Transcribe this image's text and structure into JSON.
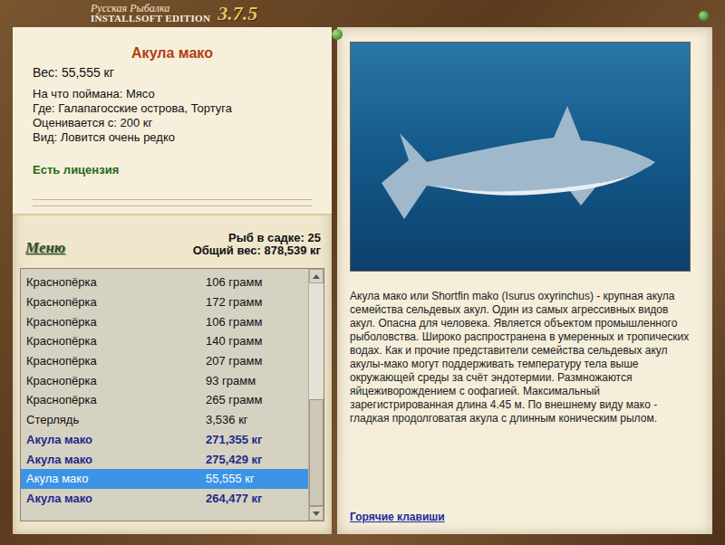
{
  "window": {
    "title_line1": "Русская Рыбалка",
    "title_line2": "INSTALLSOFT EDITION",
    "version": "3.7.5"
  },
  "fish": {
    "name": "Акула мако",
    "weight": "Вес: 55,555 кг",
    "details": [
      "На что поймана: Мясо",
      "Где: Галапагосские острова, Тортуга",
      "Оценивается с: 200 кг",
      "Вид: Ловится очень редко"
    ],
    "license": "Есть лицензия"
  },
  "menu": "Меню",
  "cage": {
    "count": "Рыб в садке: 25",
    "total": "Общий вес: 878,539 кг"
  },
  "catch_list": [
    {
      "name": "Краснопёрка",
      "weight": "106 грамм",
      "trophy": false,
      "selected": false
    },
    {
      "name": "Краснопёрка",
      "weight": "172 грамм",
      "trophy": false,
      "selected": false
    },
    {
      "name": "Краснопёрка",
      "weight": "106 грамм",
      "trophy": false,
      "selected": false
    },
    {
      "name": "Краснопёрка",
      "weight": "140 грамм",
      "trophy": false,
      "selected": false
    },
    {
      "name": "Краснопёрка",
      "weight": "207 грамм",
      "trophy": false,
      "selected": false
    },
    {
      "name": "Краснопёрка",
      "weight": "93 грамм",
      "trophy": false,
      "selected": false
    },
    {
      "name": "Краснопёрка",
      "weight": "265 грамм",
      "trophy": false,
      "selected": false
    },
    {
      "name": "Стерлядь",
      "weight": "3,536 кг",
      "trophy": false,
      "selected": false
    },
    {
      "name": "Акула мако",
      "weight": "271,355 кг",
      "trophy": true,
      "selected": false
    },
    {
      "name": "Акула мако",
      "weight": "275,429 кг",
      "trophy": true,
      "selected": false
    },
    {
      "name": "Акула мако",
      "weight": "55,555 кг",
      "trophy": false,
      "selected": true
    },
    {
      "name": "Акула мако",
      "weight": "264,477 кг",
      "trophy": true,
      "selected": false
    }
  ],
  "list_scroll": {
    "level": 1
  },
  "description": "Акула мако или Shortfin mako (Isurus oxyrinchus) - крупная акула семейства сельдевых акул. Один из самых агрессивных видов акул. Опасна для человека. Является объектом промышленного рыболовства. Широко распространена в умеренных и тропических водах. Как и прочие представители семейства сельдевых акул акулы-мако могут поддерживать температуру тела выше окружающей среды за счёт эндотермии. Размножаются яйцеживорождением с оофагией. Максимальный зарегистрированная длина 4.45 м. По внешнему виду мако - гладкая продолговатая акула с длинным коническим рылом.",
  "hotkeys": "Горячие клавиши"
}
